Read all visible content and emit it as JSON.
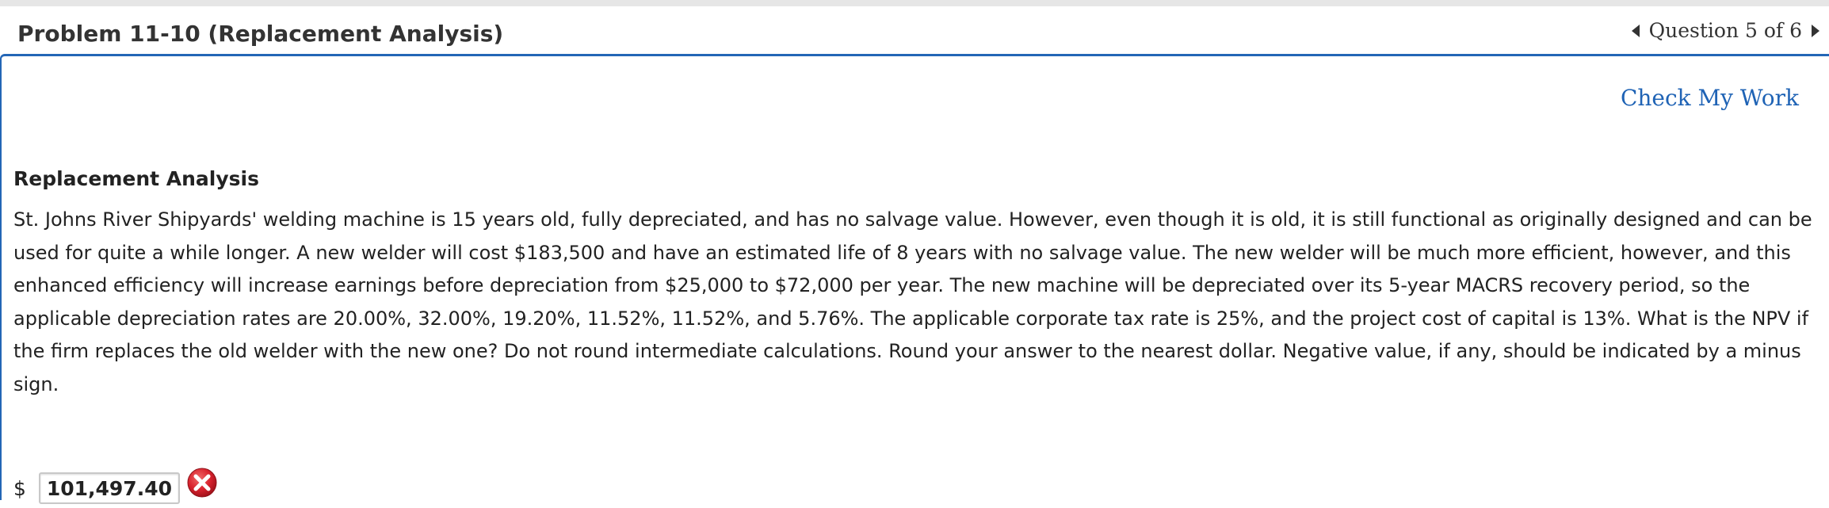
{
  "header": {
    "problem_title": "Problem 11-10 (Replacement Analysis)",
    "question_nav": "Question 5 of 6",
    "prev_icon": "triangle-left-icon",
    "next_icon": "triangle-right-icon"
  },
  "toolbar": {
    "check_my_work": "Check My Work"
  },
  "problem": {
    "heading": "Replacement Analysis",
    "text": "St. Johns River Shipyards' welding machine is 15 years old, fully depreciated, and has no salvage value. However, even though it is old, it is still functional as originally designed and can be used for quite a while longer. A new welder will cost $183,500 and have an estimated life of 8 years with no salvage value. The new welder will be much more efficient, however, and this enhanced efficiency will increase earnings before depreciation from $25,000 to $72,000 per year. The new machine will be depreciated over its 5-year MACRS recovery period, so the applicable depreciation rates are 20.00%, 32.00%, 19.20%, 11.52%, 11.52%, and 5.76%. The applicable corporate tax rate is 25%, and the project cost of capital is 13%. What is the NPV if the firm replaces the old welder with the new one? Do not round intermediate calculations. Round your answer to the nearest dollar. Negative value, if any, should be indicated by a minus sign."
  },
  "answer": {
    "currency_symbol": "$",
    "value": "101,497.40",
    "status_icon": "incorrect-x-icon"
  },
  "colors": {
    "accent_blue": "#2366b6",
    "link_blue": "#1f63b5",
    "incorrect_red": "#d9232e"
  }
}
